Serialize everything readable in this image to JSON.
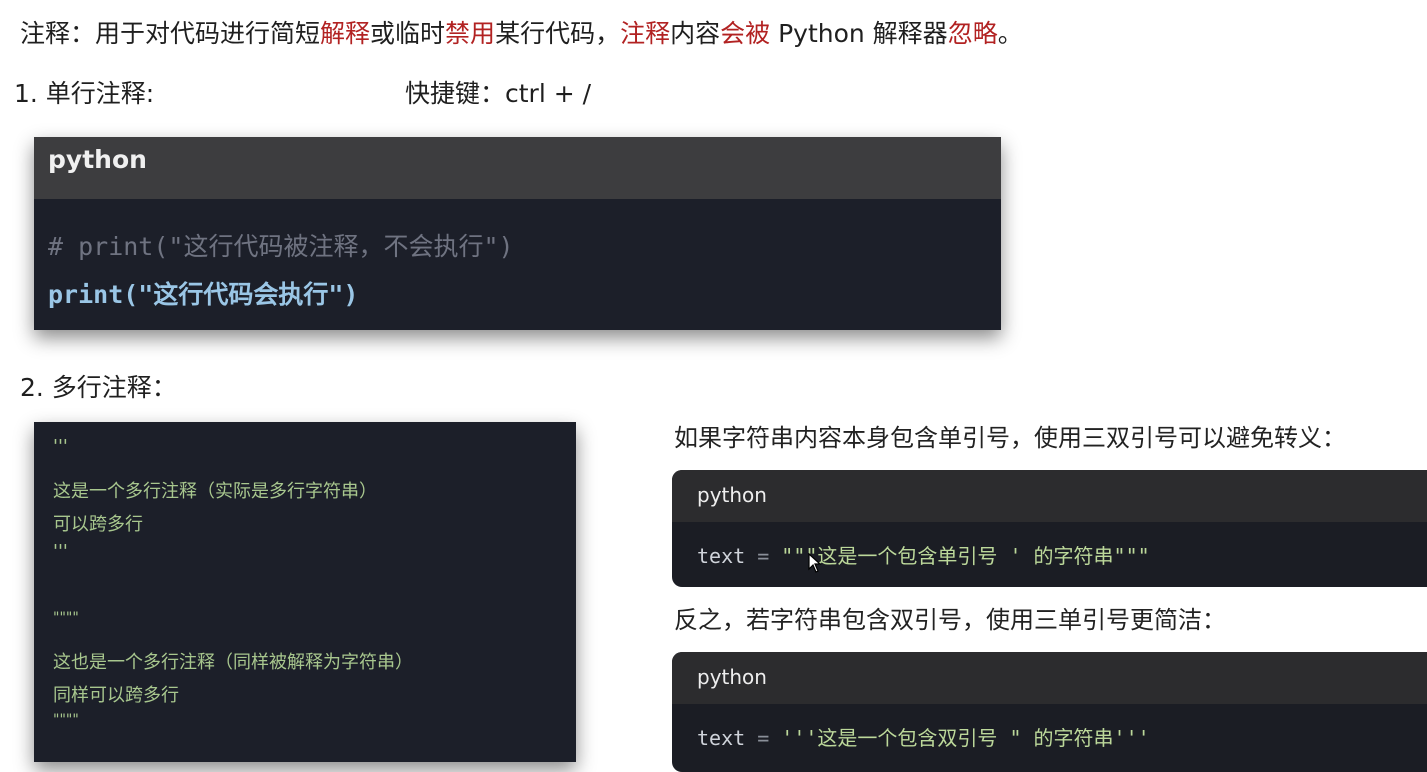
{
  "intro": {
    "p1": "注释：用于对代码进行简短",
    "r1": "解释",
    "p2": "或临时",
    "r2": "禁用",
    "p3": "某行代码，",
    "r3": "注释",
    "p4": "内容",
    "r4": "会被",
    "p5": " Python 解释器",
    "r5": "忽略",
    "p6": "。"
  },
  "section1": {
    "heading": "1. 单行注释:",
    "shortcut": "快捷键：ctrl + /"
  },
  "card1": {
    "lang": "python",
    "line1": "# print(\"这行代码被注释，不会执行\")",
    "line2": "print(\"这行代码会执行\")"
  },
  "section2": {
    "heading": "2. 多行注释："
  },
  "card2": {
    "lines": [
      "'''",
      "这是一个多行注释（实际是多行字符串）",
      "可以跨多行",
      "'''",
      "\"\"\"\"",
      "这也是一个多行注释（同样被解释为字符串）",
      "同样可以跨多行",
      "\"\"\"\""
    ]
  },
  "right": {
    "note1": "如果字符串内容本身包含单引号，使用三双引号可以避免转义：",
    "card_a": {
      "lang": "python",
      "var": "text",
      "eq": " = ",
      "str": "\"\"\"这是一个包含单引号 ' 的字符串\"\"\""
    },
    "note2": "反之，若字符串包含双引号，使用三单引号更简洁：",
    "card_b": {
      "lang": "python",
      "var": "text",
      "eq": " = ",
      "str": "'''这是一个包含双引号 \" 的字符串'''"
    }
  }
}
